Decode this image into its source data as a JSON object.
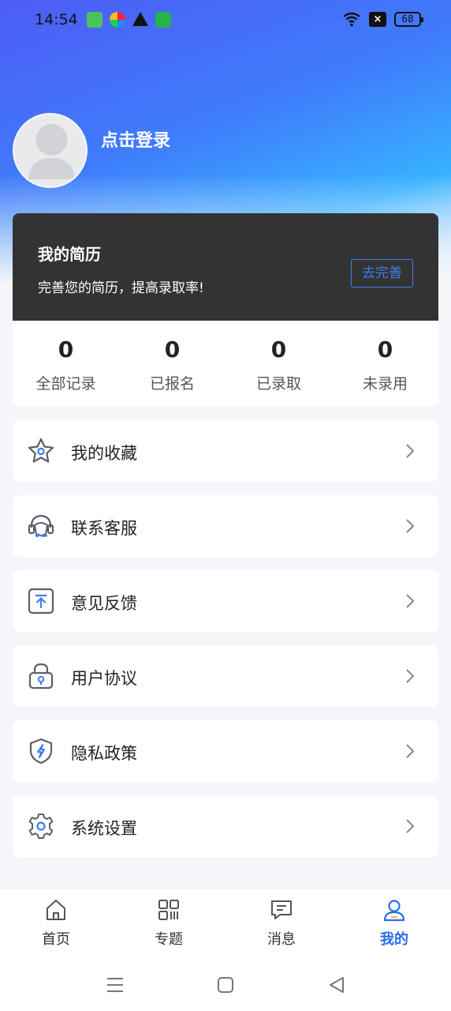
{
  "status_bar": {
    "time": "14:54",
    "battery": "68"
  },
  "profile": {
    "login_text": "点击登录"
  },
  "resume": {
    "title": "我的简历",
    "subtitle": "完善您的简历，提高录取率!",
    "button": "去完善"
  },
  "stats": [
    {
      "value": "0",
      "label": "全部记录"
    },
    {
      "value": "0",
      "label": "已报名"
    },
    {
      "value": "0",
      "label": "已录取"
    },
    {
      "value": "0",
      "label": "未录用"
    }
  ],
  "menu": [
    {
      "label": "我的收藏",
      "icon": "star-icon"
    },
    {
      "label": "联系客服",
      "icon": "headset-icon"
    },
    {
      "label": "意见反馈",
      "icon": "feedback-upload-icon"
    },
    {
      "label": "用户协议",
      "icon": "lock-icon"
    },
    {
      "label": "隐私政策",
      "icon": "shield-icon"
    },
    {
      "label": "系统设置",
      "icon": "gear-icon"
    }
  ],
  "tabs": [
    {
      "label": "首页",
      "icon": "home-icon",
      "active": false
    },
    {
      "label": "专题",
      "icon": "grid-icon",
      "active": false
    },
    {
      "label": "消息",
      "icon": "message-icon",
      "active": false
    },
    {
      "label": "我的",
      "icon": "user-icon",
      "active": true
    }
  ],
  "colors": {
    "accent": "#2a6de8",
    "resume_card": "#333333",
    "icon_gray": "#5a5f6b",
    "icon_blue": "#3d7ff0"
  }
}
